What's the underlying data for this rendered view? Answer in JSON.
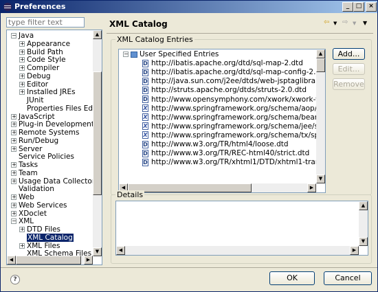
{
  "window": {
    "title": "Preferences"
  },
  "filter": {
    "placeholder": "type filter text"
  },
  "tree": {
    "items": [
      "Java",
      "Appearance",
      "Build Path",
      "Code Style",
      "Compiler",
      "Debug",
      "Editor",
      "Installed JREs",
      "JUnit",
      "Properties Files Edit",
      "JavaScript",
      "Plug-in Development",
      "Remote Systems",
      "Run/Debug",
      "Server",
      "Service Policies",
      "Tasks",
      "Team",
      "Usage Data Collector",
      "Validation",
      "Web",
      "Web Services",
      "XDoclet",
      "XML",
      "DTD Files",
      "XML Catalog",
      "XML Files",
      "XML Schema Files"
    ],
    "selected": "XML Catalog"
  },
  "page": {
    "title": "XML Catalog"
  },
  "catalog": {
    "group_label": "XML Catalog Entries",
    "root": "User Specified Entries",
    "entries": [
      "http://ibatis.apache.org/dtd/sql-map-2.dtd",
      "http://ibatis.apache.org/dtd/sql-map-config-2.dtd",
      "http://java.sun.com/j2ee/dtds/web-jsptaglibrary_1_1.d",
      "http://struts.apache.org/dtds/struts-2.0.dtd",
      "http://www.opensymphony.com/xwork/xwork-validat",
      "http://www.springframework.org/schema/aop/spring-",
      "http://www.springframework.org/schema/beans/sprin",
      "http://www.springframework.org/schema/jee/spring-",
      "http://www.springframework.org/schema/tx/spring-t",
      "http://www.w3.org/TR/html4/loose.dtd",
      "http://www.w3.org/TR/REC-html40/strict.dtd",
      "http://www.w3.org/TR/xhtml1/DTD/xhtml1-transitiona"
    ],
    "entry_icons": [
      "D",
      "D",
      "D",
      "D",
      "D",
      "X",
      "X",
      "X",
      "X",
      "D",
      "D",
      "D"
    ],
    "buttons": {
      "add": "Add...",
      "edit": "Edit...",
      "remove": "Remove"
    }
  },
  "details": {
    "group_label": "Details"
  },
  "footer": {
    "ok": "OK",
    "cancel": "Cancel",
    "help": "?"
  },
  "colors": {
    "title_start": "#0a246a",
    "title_end": "#a6caf0",
    "selection": "#0a246a"
  }
}
